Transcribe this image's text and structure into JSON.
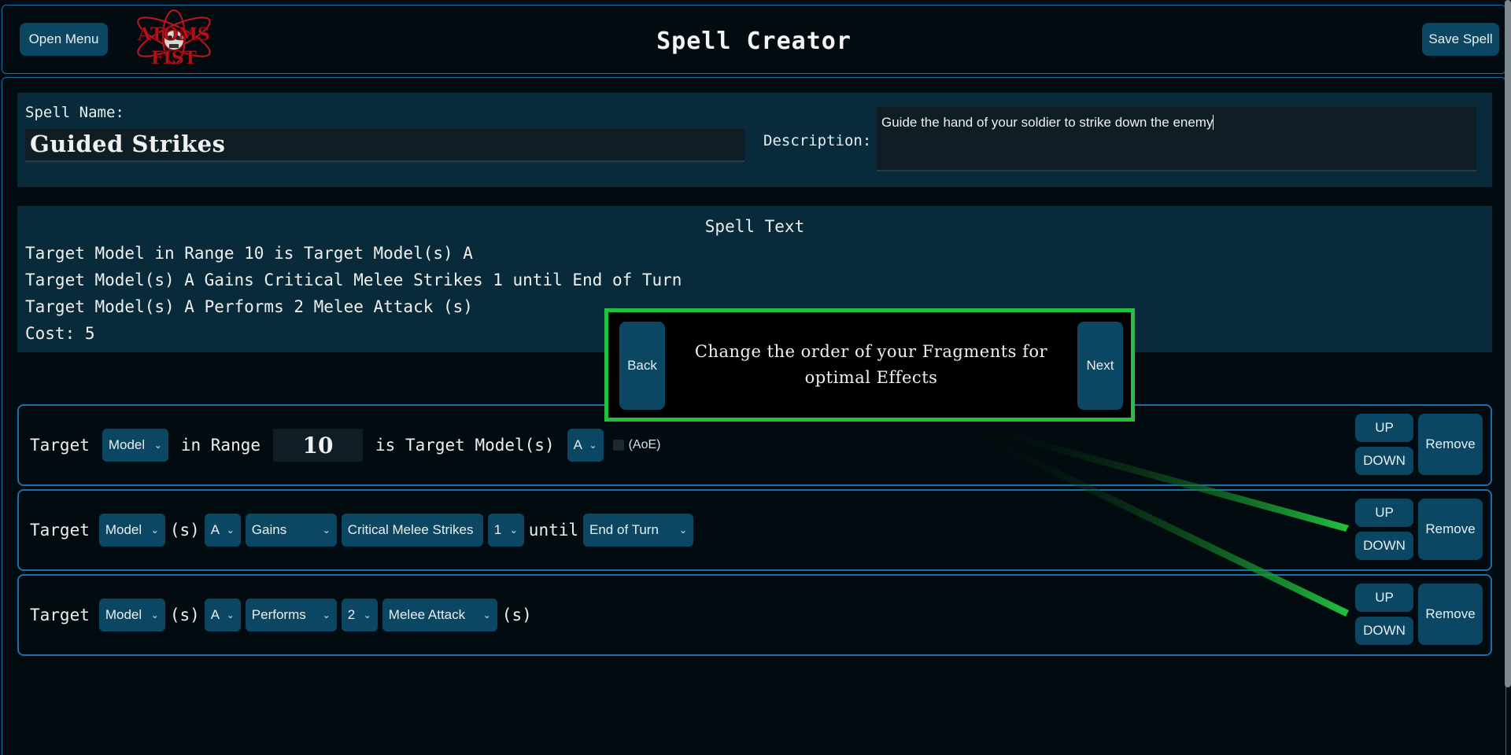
{
  "header": {
    "open_menu_label": "Open Menu",
    "title": "Spell Creator",
    "save_label": "Save Spell",
    "logo_text": "ATOMS FIST"
  },
  "spell": {
    "name_label": "Spell Name:",
    "name_value": "Guided Strikes",
    "description_label": "Description:",
    "description_value": "Guide the hand of your soldier to strike down the enemy"
  },
  "spell_text": {
    "title": "Spell Text",
    "lines": [
      "Target Model in Range 10 is Target Model(s) A",
      "Target Model(s) A Gains Critical Melee Strikes 1 until End of Turn",
      "Target Model(s) A Performs 2 Melee Attack (s)",
      "Cost: 5"
    ]
  },
  "fragments": [
    {
      "target_word": "Target",
      "target_select": "Model",
      "in_range_word": "in Range",
      "range_value": "10",
      "is_target_word": "is Target Model(s)",
      "group_select": "A",
      "aoe_label": "(AoE)",
      "up": "UP",
      "down": "DOWN",
      "remove": "Remove"
    },
    {
      "target_word": "Target",
      "target_select": "Model",
      "s_word": "(s)",
      "group_select": "A",
      "verb_select": "Gains",
      "effect_select": "Critical Melee Strikes",
      "amount_select": "1",
      "until_word": "until",
      "duration_select": "End of Turn",
      "up": "UP",
      "down": "DOWN",
      "remove": "Remove"
    },
    {
      "target_word": "Target",
      "target_select": "Model",
      "s_word": "(s)",
      "group_select": "A",
      "verb_select": "Performs",
      "amount_select": "2",
      "action_select": "Melee Attack",
      "s_suffix": "(s)",
      "up": "UP",
      "down": "DOWN",
      "remove": "Remove"
    }
  ],
  "tour": {
    "back_label": "Back",
    "next_label": "Next",
    "message": "Change the order of your Fragments for optimal Effects"
  },
  "colors": {
    "accent_border": "#1d6fa5",
    "button_bg": "#0b4763",
    "tour_highlight": "#22c13f"
  }
}
